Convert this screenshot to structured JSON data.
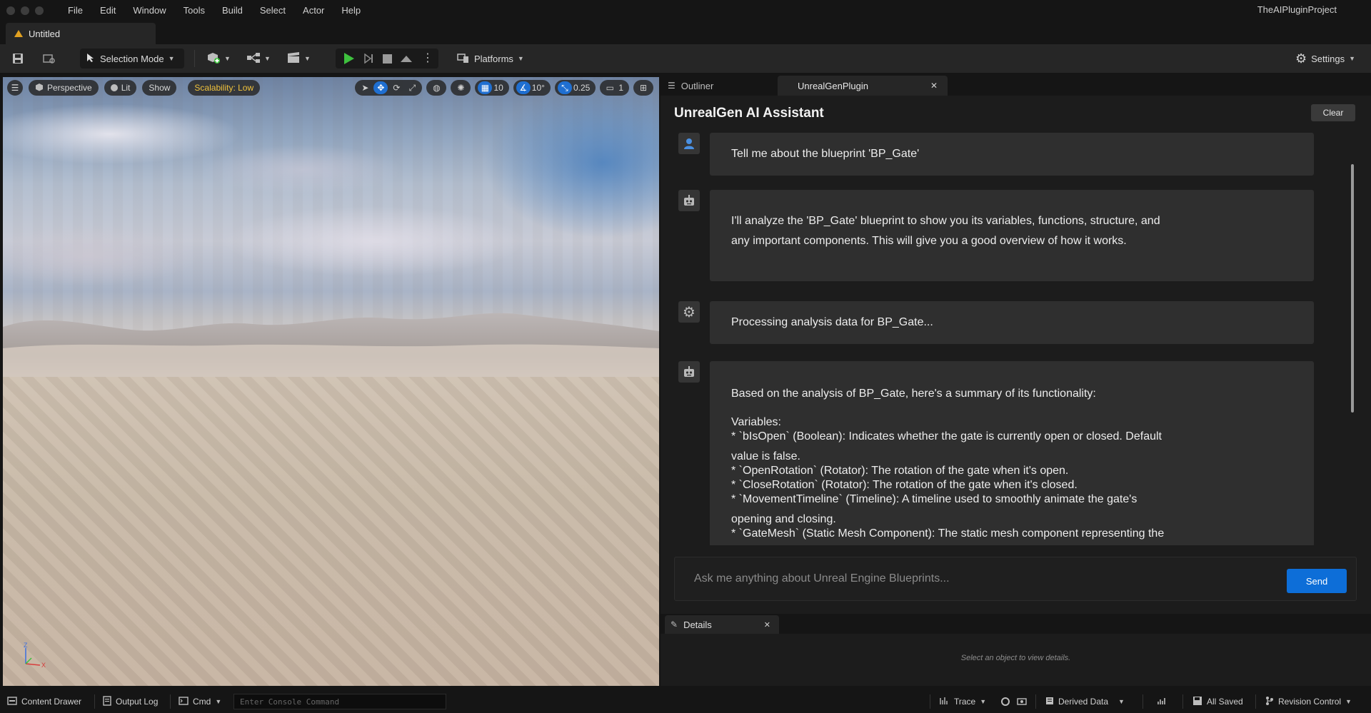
{
  "menubar": {
    "items": [
      "File",
      "Edit",
      "Window",
      "Tools",
      "Build",
      "Select",
      "Actor",
      "Help"
    ],
    "project_name": "TheAIPluginProject"
  },
  "level_tab": {
    "label": "Untitled"
  },
  "toolbar": {
    "selection_mode": "Selection Mode",
    "platforms": "Platforms",
    "settings": "Settings"
  },
  "viewport": {
    "perspective": "Perspective",
    "lit": "Lit",
    "show": "Show",
    "scalability": "Scalability: Low",
    "grid_snap": "10",
    "rotation_snap": "10°",
    "scale_snap": "0.25",
    "camera_speed": "1",
    "axis_z": "Z",
    "axis_x": "X"
  },
  "right_tabs": {
    "outliner": "Outliner",
    "plugin": "UnrealGenPlugin"
  },
  "chat": {
    "title": "UnrealGen AI Assistant",
    "clear_label": "Clear",
    "messages": [
      {
        "role": "user",
        "icon": "user-icon",
        "lines": [
          "Tell me about the blueprint 'BP_Gate'"
        ]
      },
      {
        "role": "assistant",
        "icon": "robot-icon",
        "lines": [
          "I'll analyze the 'BP_Gate' blueprint to show you its variables, functions, structure, and",
          "any important components. This will give you a good overview of how it works."
        ]
      },
      {
        "role": "system",
        "icon": "gear-icon",
        "lines": [
          "Processing analysis data for BP_Gate..."
        ]
      },
      {
        "role": "assistant",
        "icon": "robot-icon",
        "lines": [
          "Based on the analysis of BP_Gate, here's a summary of its functionality:",
          "Variables:",
          "*   `bIsOpen` (Boolean): Indicates whether the gate is currently open or closed. Default",
          "value is false.",
          "*   `OpenRotation` (Rotator): The rotation of the gate when it's open.",
          "*   `CloseRotation` (Rotator): The rotation of the gate when it's closed.",
          "*   `MovementTimeline` (Timeline): A timeline used to smoothly animate the gate's",
          "opening and closing.",
          "*   `GateMesh` (Static Mesh Component): The static mesh component representing the"
        ]
      }
    ],
    "input_placeholder": "Ask me anything about Unreal Engine Blueprints...",
    "send_label": "Send"
  },
  "details": {
    "tab_label": "Details",
    "hint": "Select an object to view details."
  },
  "statusbar": {
    "content_drawer": "Content Drawer",
    "output_log": "Output Log",
    "cmd": "Cmd",
    "console_placeholder": "Enter Console Command",
    "trace": "Trace",
    "derived_data": "Derived Data",
    "all_saved": "All Saved",
    "revision_control": "Revision Control"
  },
  "colors": {
    "accent": "#0d6ed8",
    "play_green": "#3ec13e",
    "scalability_yellow": "#f0c23c"
  }
}
